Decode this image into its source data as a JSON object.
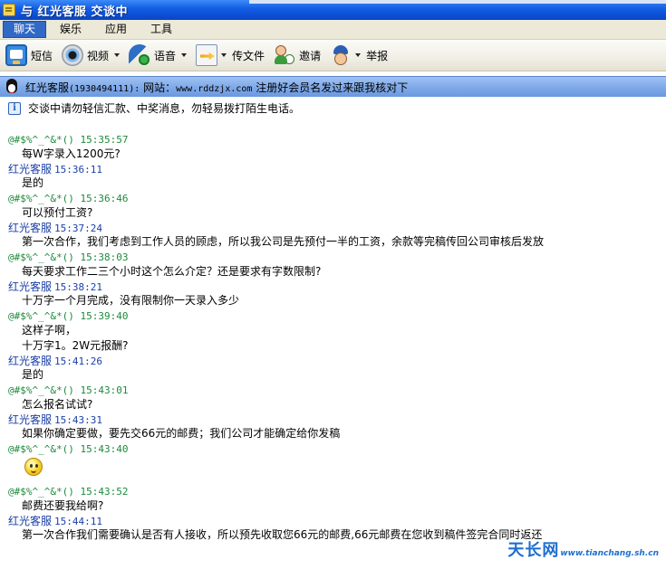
{
  "window": {
    "title": "与 红光客服 交谈中"
  },
  "menu": {
    "items": [
      {
        "label": "聊天"
      },
      {
        "label": "娱乐"
      },
      {
        "label": "应用"
      },
      {
        "label": "工具"
      }
    ]
  },
  "toolbar": {
    "sms_label": "短信",
    "video_label": "视频",
    "voice_label": "语音",
    "file_label": "传文件",
    "invite_label": "邀请",
    "report_label": "举报"
  },
  "contact": {
    "name": "红光客服",
    "qq": "(1930494111):",
    "site_prefix": "网站：",
    "site_url": "www.rddzjx.com",
    "status": "注册好会员名发过来跟我核对下"
  },
  "notice": {
    "text": "交谈中请勿轻信汇款、中奖消息，勿轻易拨打陌生电话。"
  },
  "messages": [
    {
      "sender": "@#$%^_^&*()",
      "time": "15:35:57",
      "lines": [
        "每W字录入1200元?"
      ]
    },
    {
      "sender": "红光客服",
      "time": "15:36:11",
      "lines": [
        "是的"
      ]
    },
    {
      "sender": "@#$%^_^&*()",
      "time": "15:36:46",
      "lines": [
        "可以预付工资?"
      ]
    },
    {
      "sender": "红光客服",
      "time": "15:37:24",
      "lines": [
        "第一次合作，我们考虑到工作人员的顾虑，所以我公司是先预付一半的工资，余款等完稿传回公司审核后发放"
      ]
    },
    {
      "sender": "@#$%^_^&*()",
      "time": "15:38:03",
      "lines": [
        "每天要求工作二三个小时这个怎么介定？还是要求有字数限制?"
      ]
    },
    {
      "sender": "红光客服",
      "time": "15:38:21",
      "lines": [
        "十万字一个月完成，没有限制你一天录入多少"
      ]
    },
    {
      "sender": "@#$%^_^&*()",
      "time": "15:39:40",
      "lines": [
        "这样子啊，",
        "十万字1。2W元报酬?"
      ]
    },
    {
      "sender": "红光客服",
      "time": "15:41:26",
      "lines": [
        "是的"
      ]
    },
    {
      "sender": "@#$%^_^&*()",
      "time": "15:43:01",
      "lines": [
        "怎么报名试试?"
      ]
    },
    {
      "sender": "红光客服",
      "time": "15:43:31",
      "lines": [
        "如果你确定要做，要先交66元的邮费；我们公司才能确定给你发稿"
      ]
    },
    {
      "sender": "@#$%^_^&*()",
      "time": "15:43:40",
      "lines": [],
      "emoticon": "smiley-icon"
    },
    {
      "sender": "@#$%^_^&*()",
      "time": "15:43:52",
      "lines": [
        "邮费还要我给啊?"
      ]
    },
    {
      "sender": "红光客服",
      "time": "15:44:11",
      "lines": [
        "第一次合作我们需要确认是否有人接收，所以预先收取您66元的邮费,66元邮费在您收到稿件签完合同时返还"
      ]
    }
  ],
  "watermark": {
    "main": "天长网",
    "url": "www.tianchang.sh.cn"
  },
  "colors": {
    "title_bar": "#0b4fd6",
    "menu_active": "#3169c6",
    "self_sender": "#1d8a3c",
    "other_sender": "#1a3fa8",
    "watermark": "#1e6fd0"
  }
}
